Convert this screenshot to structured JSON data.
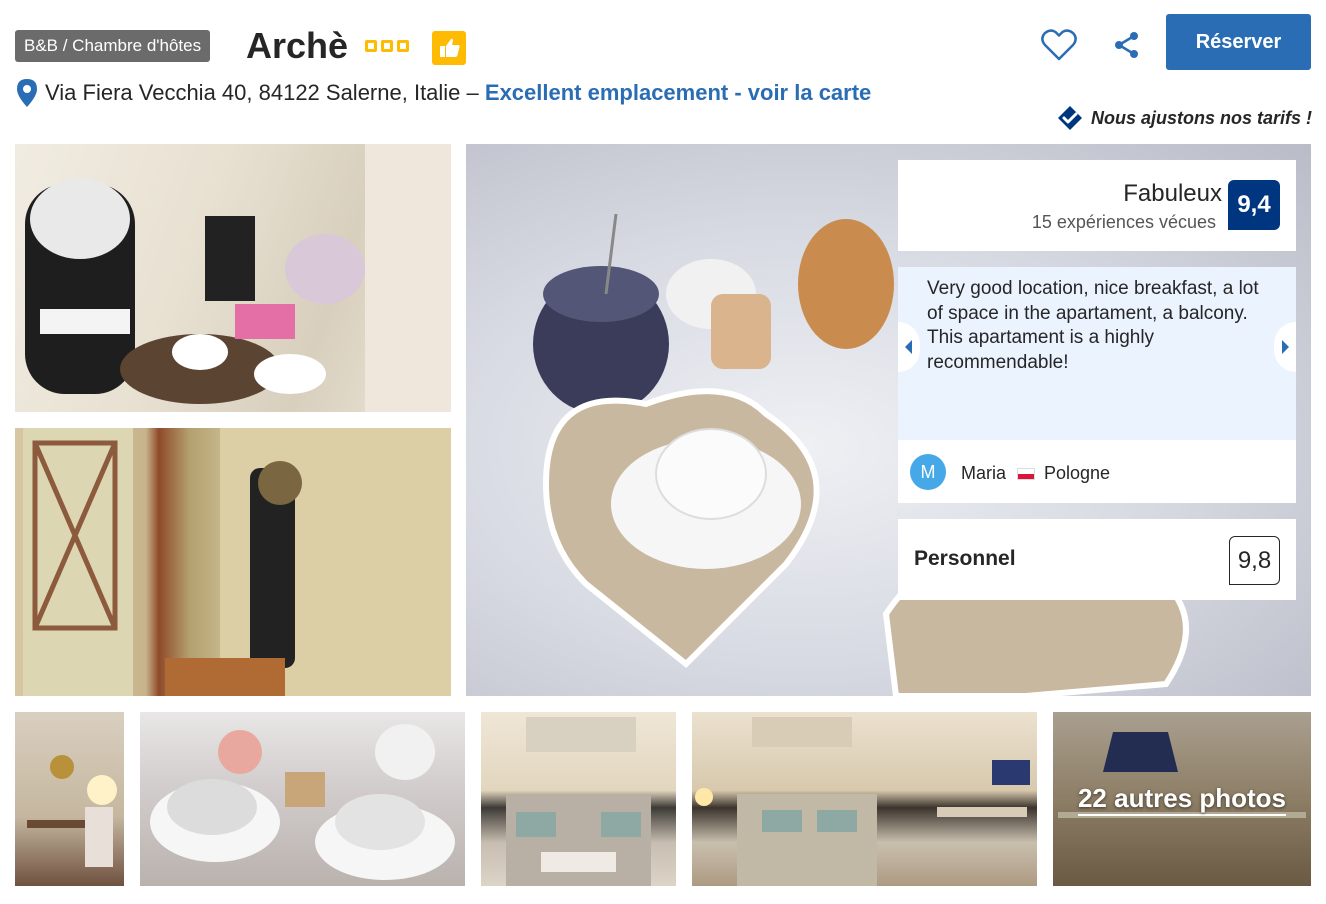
{
  "header": {
    "property_type": "B&B / Chambre d'hôtes",
    "hotel_name": "Archè",
    "star_count": 3,
    "reserve_label": "Réserver",
    "favorite_icon": "heart-icon",
    "share_icon": "share-icon",
    "accent_color": "#2a6db5",
    "star_color": "#febb02"
  },
  "address": {
    "text": "Via Fiera Vecchia 40, 84122 Salerne, Italie – ",
    "link_label": "Excellent emplacement - voir la carte",
    "pin_icon": "map-pin-icon"
  },
  "price_note": {
    "label": "Nous ajustons nos tarifs !",
    "icon": "checked-badge-icon"
  },
  "gallery": {
    "more_photos_label": "22 autres photos"
  },
  "review": {
    "rating_word": "Fabuleux",
    "experiences": "15 expériences vécues",
    "score": "9,4",
    "score_color": "#003580",
    "text": "Very good location, nice breakfast, a lot of space in the apartament, a balcony. This apartament is a highly recommendable!",
    "reviewer_initial": "M",
    "reviewer_name": "Maria",
    "reviewer_country": "Pologne",
    "staff_label": "Personnel",
    "staff_score": "9,8"
  }
}
